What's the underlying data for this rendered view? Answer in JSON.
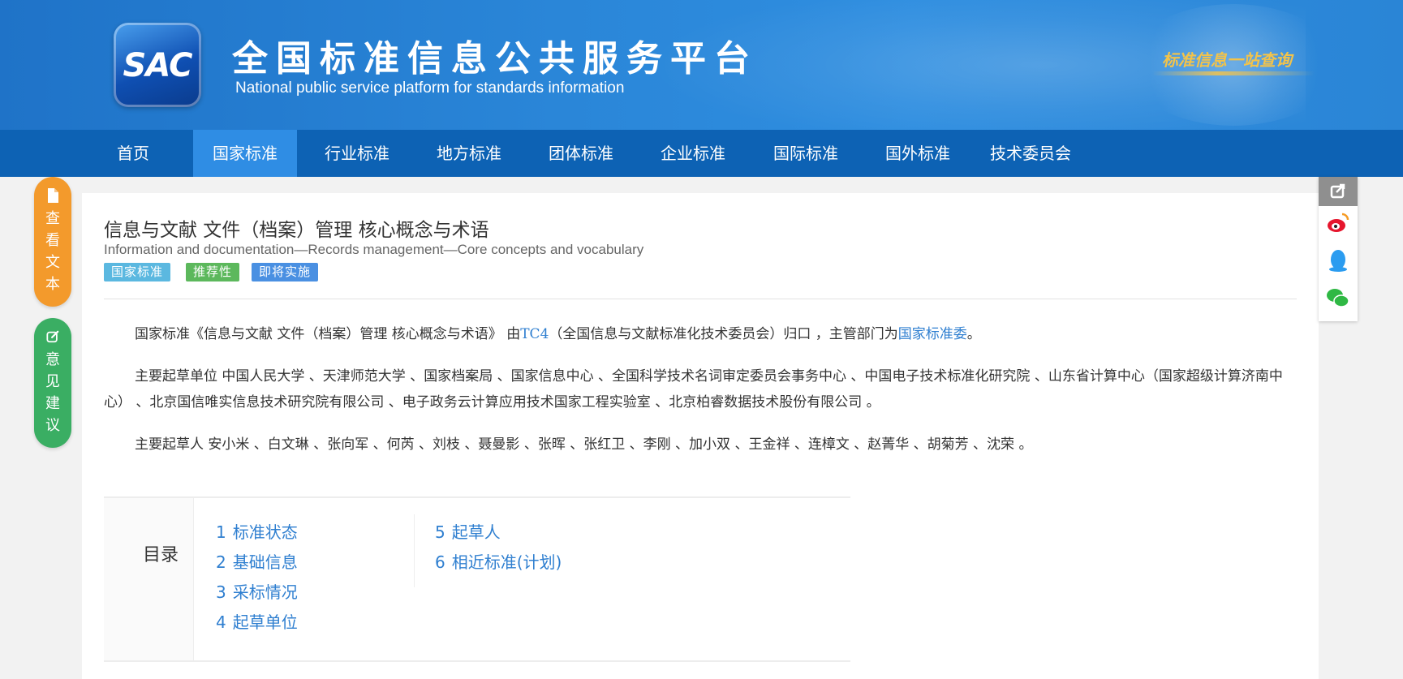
{
  "header": {
    "logo_text": "SAC",
    "title": "全国标准信息公共服务平台",
    "subtitle": "National public service platform  for standards information",
    "slogan": "标准信息一站查询"
  },
  "nav": {
    "items": [
      {
        "label": "首页",
        "active": false
      },
      {
        "label": "国家标准",
        "active": true
      },
      {
        "label": "行业标准",
        "active": false
      },
      {
        "label": "地方标准",
        "active": false
      },
      {
        "label": "团体标准",
        "active": false
      },
      {
        "label": "企业标准",
        "active": false
      },
      {
        "label": "国际标准",
        "active": false
      },
      {
        "label": "国外标准",
        "active": false
      },
      {
        "label": "技术委员会",
        "active": false
      }
    ]
  },
  "float_left": {
    "view_text": [
      "查",
      "看",
      "文",
      "本"
    ],
    "feedback": [
      "意",
      "见",
      "建",
      "议"
    ]
  },
  "share": {
    "icons": [
      "share-icon",
      "weibo-icon",
      "qq-icon",
      "wechat-icon"
    ]
  },
  "standard": {
    "title_cn": "信息与文献 文件（档案）管理 核心概念与术语",
    "title_en": "Information and documentation—Records management—Core concepts and vocabulary",
    "badges": [
      {
        "label": "国家标准",
        "color": "#5bb8e0"
      },
      {
        "label": "推荐性",
        "color": "#5cb85c"
      },
      {
        "label": "即将实施",
        "color": "#4a90e2"
      }
    ],
    "para1": {
      "prefix": "国家标准《信息与文献 文件（档案）管理 核心概念与术语》 由",
      "tc_link": "TC4",
      "middle": "（全国信息与文献标准化技术委员会）归口 ，主管部门为",
      "dept_link": "国家标准委",
      "suffix": "。"
    },
    "para2": "主要起草单位 中国人民大学 、天津师范大学 、国家档案局 、国家信息中心 、全国科学技术名词审定委员会事务中心 、中国电子技术标准化研究院 、山东省计算中心（国家超级计算济南中心） 、北京国信唯实信息技术研究院有限公司 、电子政务云计算应用技术国家工程实验室 、北京柏睿数据技术股份有限公司 。",
    "para3": "主要起草人 安小米 、白文琳 、张向军 、何芮 、刘枝 、聂曼影 、张晖 、张红卫 、李刚 、加小双 、王金祥 、连樟文 、赵菁华 、胡菊芳 、沈荣 。"
  },
  "toc": {
    "label": "目录",
    "items": [
      {
        "num": "1",
        "label": "标准状态"
      },
      {
        "num": "2",
        "label": "基础信息"
      },
      {
        "num": "3",
        "label": "采标情况"
      },
      {
        "num": "4",
        "label": "起草单位"
      },
      {
        "num": "5",
        "label": "起草人"
      },
      {
        "num": "6",
        "label": "相近标准(计划)"
      }
    ]
  }
}
